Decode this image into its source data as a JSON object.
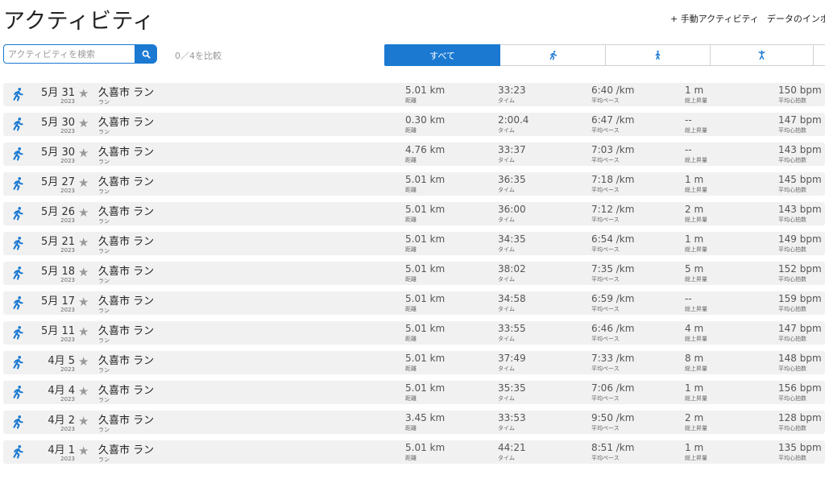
{
  "header": {
    "title": "アクティビティ",
    "manual_activity": "+ 手動アクティビティ",
    "import_data": "データのインポート"
  },
  "search": {
    "placeholder": "アクティビティを検索",
    "compare": "0／4を比較"
  },
  "tabs": {
    "all_label": "すべて",
    "icons": [
      "running-icon",
      "walking-icon",
      "fitness-icon"
    ]
  },
  "labels": {
    "distance": "距離",
    "time": "タイム",
    "pace": "平均ペース",
    "elevation": "総上昇量",
    "heart_rate": "平均心拍数"
  },
  "colors": {
    "accent": "#1b79d2",
    "row_bg": "#f1f1f1"
  },
  "activities": [
    {
      "date": "5月 31",
      "year": "2023",
      "title": "久喜市 ラン",
      "type": "ラン",
      "distance": "5.01 km",
      "time": "33:23",
      "pace": "6:40 /km",
      "elevation": "1 m",
      "heart_rate": "150 bpm"
    },
    {
      "date": "5月 30",
      "year": "2023",
      "title": "久喜市 ラン",
      "type": "ラン",
      "distance": "0.30 km",
      "time": "2:00.4",
      "pace": "6:47 /km",
      "elevation": "--",
      "heart_rate": "147 bpm"
    },
    {
      "date": "5月 30",
      "year": "2023",
      "title": "久喜市 ラン",
      "type": "ラン",
      "distance": "4.76 km",
      "time": "33:37",
      "pace": "7:03 /km",
      "elevation": "--",
      "heart_rate": "143 bpm"
    },
    {
      "date": "5月 27",
      "year": "2023",
      "title": "久喜市 ラン",
      "type": "ラン",
      "distance": "5.01 km",
      "time": "36:35",
      "pace": "7:18 /km",
      "elevation": "1 m",
      "heart_rate": "145 bpm"
    },
    {
      "date": "5月 26",
      "year": "2023",
      "title": "久喜市 ラン",
      "type": "ラン",
      "distance": "5.01 km",
      "time": "36:00",
      "pace": "7:12 /km",
      "elevation": "2 m",
      "heart_rate": "143 bpm"
    },
    {
      "date": "5月 21",
      "year": "2023",
      "title": "久喜市 ラン",
      "type": "ラン",
      "distance": "5.01 km",
      "time": "34:35",
      "pace": "6:54 /km",
      "elevation": "1 m",
      "heart_rate": "149 bpm"
    },
    {
      "date": "5月 18",
      "year": "2023",
      "title": "久喜市 ラン",
      "type": "ラン",
      "distance": "5.01 km",
      "time": "38:02",
      "pace": "7:35 /km",
      "elevation": "5 m",
      "heart_rate": "152 bpm"
    },
    {
      "date": "5月 17",
      "year": "2023",
      "title": "久喜市 ラン",
      "type": "ラン",
      "distance": "5.01 km",
      "time": "34:58",
      "pace": "6:59 /km",
      "elevation": "--",
      "heart_rate": "159 bpm"
    },
    {
      "date": "5月 11",
      "year": "2023",
      "title": "久喜市 ラン",
      "type": "ラン",
      "distance": "5.01 km",
      "time": "33:55",
      "pace": "6:46 /km",
      "elevation": "4 m",
      "heart_rate": "147 bpm"
    },
    {
      "date": "4月 5",
      "year": "2023",
      "title": "久喜市 ラン",
      "type": "ラン",
      "distance": "5.01 km",
      "time": "37:49",
      "pace": "7:33 /km",
      "elevation": "8 m",
      "heart_rate": "148 bpm"
    },
    {
      "date": "4月 4",
      "year": "2023",
      "title": "久喜市 ラン",
      "type": "ラン",
      "distance": "5.01 km",
      "time": "35:35",
      "pace": "7:06 /km",
      "elevation": "1 m",
      "heart_rate": "156 bpm"
    },
    {
      "date": "4月 2",
      "year": "2023",
      "title": "久喜市 ラン",
      "type": "ラン",
      "distance": "3.45 km",
      "time": "33:53",
      "pace": "9:50 /km",
      "elevation": "2 m",
      "heart_rate": "128 bpm"
    },
    {
      "date": "4月 1",
      "year": "2023",
      "title": "久喜市 ラン",
      "type": "ラン",
      "distance": "5.01 km",
      "time": "44:21",
      "pace": "8:51 /km",
      "elevation": "1 m",
      "heart_rate": "135 bpm"
    }
  ]
}
